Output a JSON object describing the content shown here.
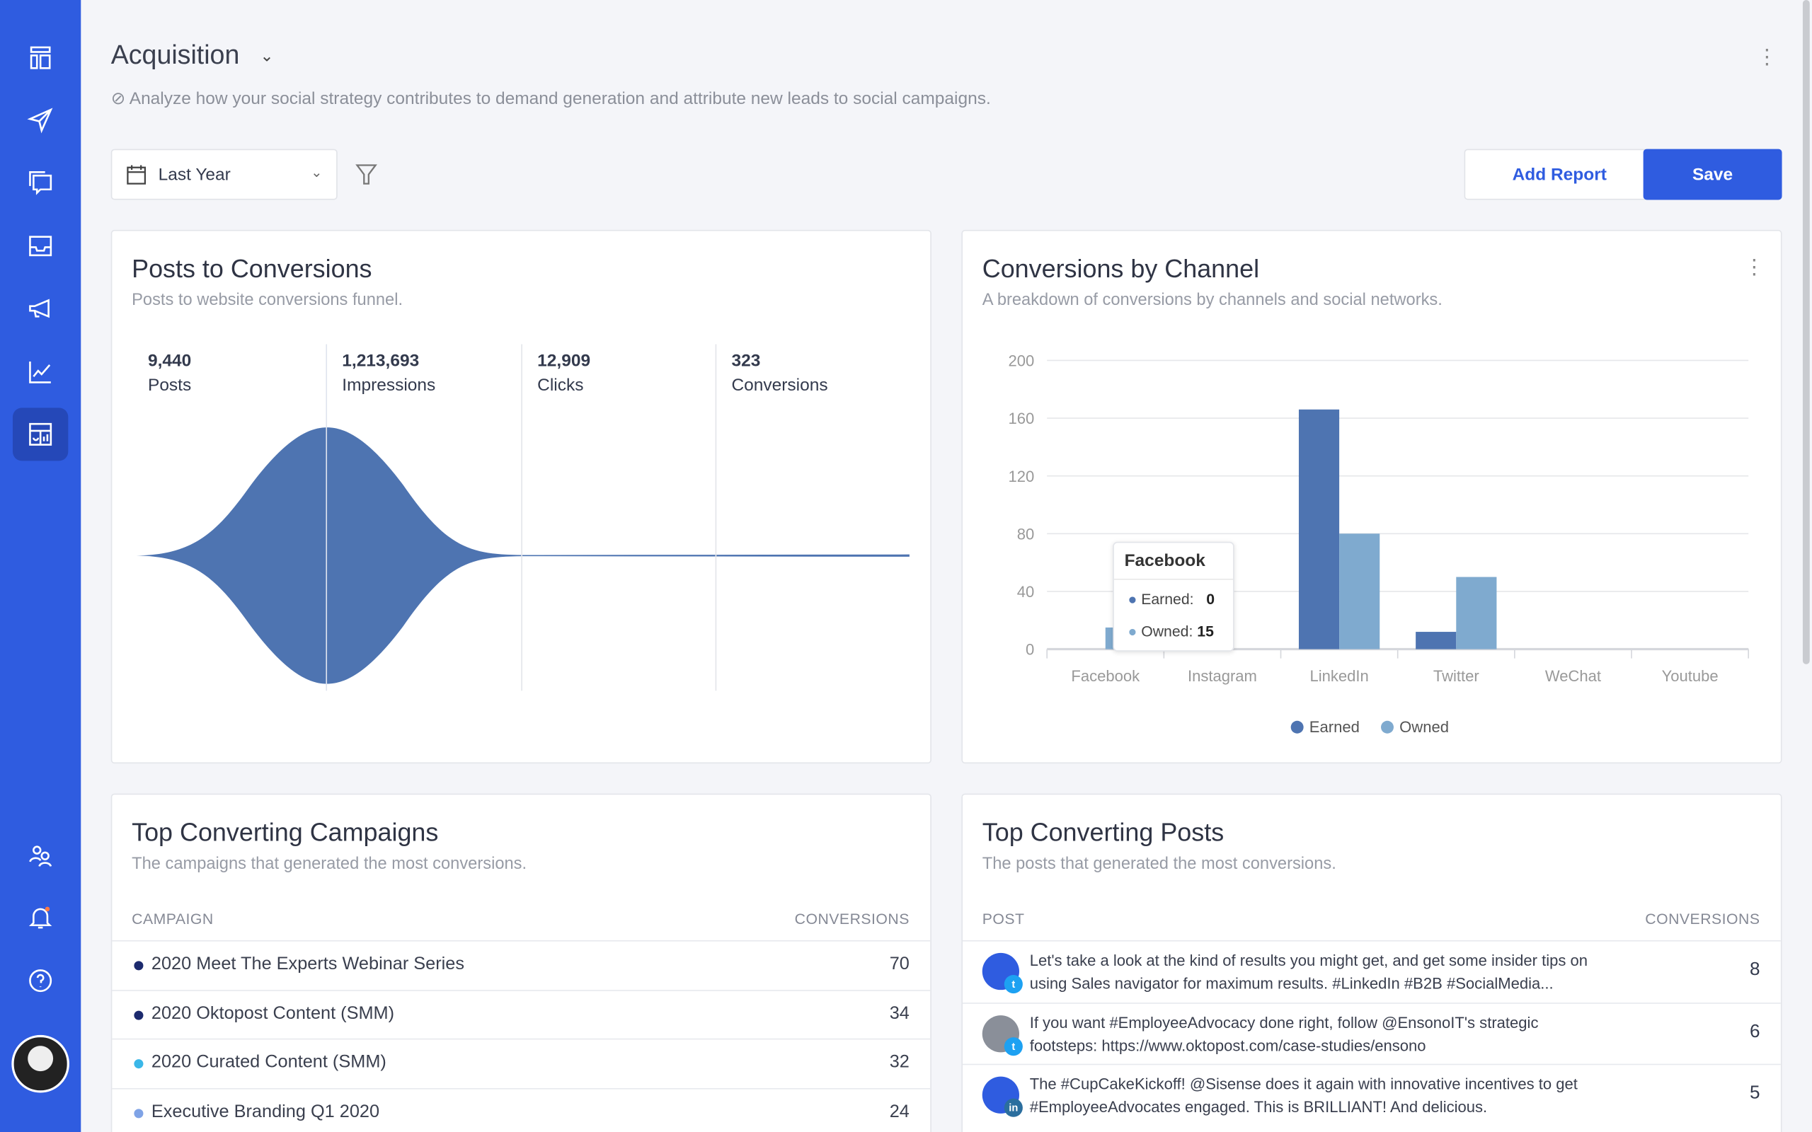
{
  "colors": {
    "accent": "#2f5ce0",
    "earned": "#4e74b1",
    "owned": "#7faacf"
  },
  "sidebar": {
    "items": [
      "layout-icon",
      "send-icon",
      "chat-icon",
      "inbox-icon",
      "megaphone-icon",
      "analytics-icon",
      "reports-icon",
      "team-icon",
      "bell-icon",
      "help-icon"
    ],
    "active": "reports-icon"
  },
  "header": {
    "title": "Acquisition",
    "subtitle": "Analyze how your social strategy contributes to demand generation and attribute new leads to social campaigns."
  },
  "toolbar": {
    "date_range": "Last Year",
    "add_report": "Add Report",
    "save": "Save"
  },
  "funnel": {
    "title": "Posts to Conversions",
    "desc": "Posts to website conversions funnel.",
    "metrics": [
      {
        "value": "9,440",
        "label": "Posts"
      },
      {
        "value": "1,213,693",
        "label": "Impressions"
      },
      {
        "value": "12,909",
        "label": "Clicks"
      },
      {
        "value": "323",
        "label": "Conversions"
      }
    ]
  },
  "channels": {
    "title": "Conversions by Channel",
    "desc": "A breakdown of conversions by channels and social networks.",
    "tooltip": {
      "title": "Facebook",
      "earned_label": "Earned:",
      "earned": "0",
      "owned_label": "Owned:",
      "owned": "15"
    }
  },
  "chart_data": {
    "type": "bar",
    "categories": [
      "Facebook",
      "Instagram",
      "LinkedIn",
      "Twitter",
      "WeChat",
      "Youtube"
    ],
    "series": [
      {
        "name": "Earned",
        "values": [
          0,
          0,
          166,
          12,
          0,
          0
        ]
      },
      {
        "name": "Owned",
        "values": [
          15,
          0,
          80,
          50,
          0,
          0
        ]
      }
    ],
    "ylim": [
      0,
      200
    ],
    "yticks": [
      "0",
      "40",
      "80",
      "120",
      "160",
      "200"
    ],
    "grid": true,
    "legend": "bottom"
  },
  "campaigns": {
    "title": "Top Converting Campaigns",
    "desc": "The campaigns that generated the most conversions.",
    "col1": "CAMPAIGN",
    "col2": "CONVERSIONS",
    "rows": [
      {
        "name": "2020 Meet The Experts Webinar Series",
        "value": "70",
        "color": "#1c2a6e"
      },
      {
        "name": "2020 Oktopost Content (SMM)",
        "value": "34",
        "color": "#1c2a6e"
      },
      {
        "name": "2020 Curated Content (SMM)",
        "value": "32",
        "color": "#3ab7e8"
      },
      {
        "name": "Executive Branding Q1 2020",
        "value": "24",
        "color": "#7fa3e6"
      }
    ]
  },
  "posts": {
    "title": "Top Converting Posts",
    "desc": "The posts that generated the most conversions.",
    "col1": "POST",
    "col2": "CONVERSIONS",
    "rows": [
      {
        "text": "Let's take a look at the kind of results you might get, and get some insider tips on using Sales navigator for maximum results. #LinkedIn #B2B #SocialMedia...",
        "value": "8",
        "network": "twitter"
      },
      {
        "text": "If you want #EmployeeAdvocacy done right, follow @EnsonoIT's strategic footsteps: https://www.oktopost.com/case-studies/ensono",
        "value": "6",
        "network": "twitter"
      },
      {
        "text": "The #CupCakeKickoff! @Sisense does it again with innovative incentives to get #EmployeeAdvocates engaged. This is BRILLIANT! And delicious.",
        "value": "5",
        "network": "linkedin"
      }
    ]
  }
}
